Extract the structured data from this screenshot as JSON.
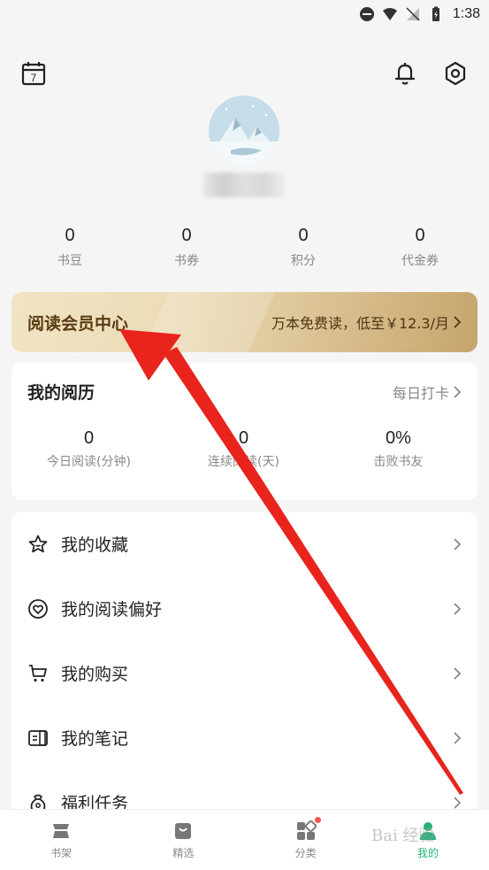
{
  "status_bar": {
    "time": "1:38"
  },
  "header": {
    "calendar_day": "7"
  },
  "stats": [
    {
      "value": "0",
      "label": "书豆"
    },
    {
      "value": "0",
      "label": "书券"
    },
    {
      "value": "0",
      "label": "积分"
    },
    {
      "value": "0",
      "label": "代金券"
    }
  ],
  "vip": {
    "title": "阅读会员中心",
    "desc": "万本免费读，低至￥12.3/月"
  },
  "reading": {
    "title": "我的阅历",
    "link": "每日打卡",
    "stats": [
      {
        "value": "0",
        "label": "今日阅读(分钟)"
      },
      {
        "value": "0",
        "label": "连续阅读(天)"
      },
      {
        "value": "0%",
        "label": "击败书友"
      }
    ]
  },
  "menu": [
    {
      "label": "我的收藏",
      "icon": "star-icon"
    },
    {
      "label": "我的阅读偏好",
      "icon": "heart-icon"
    },
    {
      "label": "我的购买",
      "icon": "cart-icon"
    },
    {
      "label": "我的笔记",
      "icon": "note-icon"
    },
    {
      "label": "福利任务",
      "icon": "gift-bag-icon"
    }
  ],
  "tabbar": [
    {
      "label": "书架"
    },
    {
      "label": "精选"
    },
    {
      "label": "分类"
    },
    {
      "label": "我的"
    }
  ],
  "watermark": "Bai 经验",
  "colors": {
    "accent": "#27b27a",
    "vip_text": "#5a3b12",
    "arrow": "#e8241d"
  }
}
